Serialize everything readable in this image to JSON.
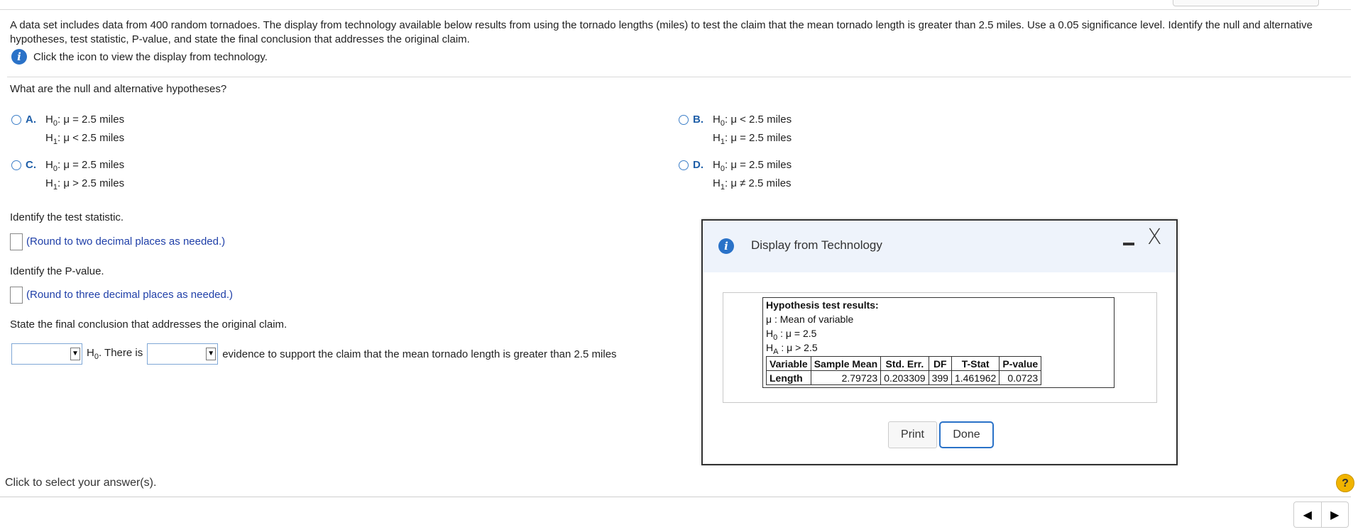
{
  "problem_text": "A data set includes data from 400 random tornadoes. The display from technology available below results from using the tornado lengths (miles) to test the claim that the mean tornado length is greater than 2.5 miles. Use a 0.05 significance level. Identify the null and alternative hypotheses, test statistic, P-value, and state the final conclusion that addresses the original claim.",
  "info_link": "Click the icon to view the display from technology.",
  "info_icon": "i",
  "q1": "What are the null and alternative hypotheses?",
  "options": [
    {
      "letter": "A.",
      "h0": "μ = 2.5 miles",
      "h1": "μ < 2.5 miles"
    },
    {
      "letter": "B.",
      "h0": "μ < 2.5 miles",
      "h1": "μ = 2.5 miles"
    },
    {
      "letter": "C.",
      "h0": "μ = 2.5 miles",
      "h1": "μ > 2.5 miles"
    },
    {
      "letter": "D.",
      "h0": "μ = 2.5 miles",
      "h1": "μ ≠ 2.5 miles"
    }
  ],
  "h_labels": {
    "H": "H",
    "sub0": "0",
    "sub1": "1",
    "colon": ":"
  },
  "q2": "Identify the test statistic.",
  "q2_hint": "(Round to two decimal places as needed.)",
  "q3": "Identify the P-value.",
  "q3_hint": "(Round to three decimal places as needed.)",
  "q4": "State the final conclusion that addresses the original claim.",
  "conclusion": {
    "h": "H",
    "sub": "0",
    "middle": ". There is",
    "tail": "evidence to support the claim that the mean tornado length is greater than 2.5 miles",
    "select1_value": "",
    "select2_value": "",
    "arrow": "▼"
  },
  "footer": "Click to select your answer(s).",
  "help": "?",
  "nav": {
    "prev": "◀",
    "next": "▶"
  },
  "dialog": {
    "title": "Display from Technology",
    "close": "X",
    "results_title": "Hypothesis test results:",
    "mu_line": "μ : Mean of variable",
    "h0_line": "μ = 2.5",
    "ha_line": "μ > 2.5",
    "h0_label": "H",
    "h0_sub": "0",
    "ha_label": "H",
    "ha_sub": "A",
    "headers": [
      "Variable",
      "Sample Mean",
      "Std. Err.",
      "DF",
      "T-Stat",
      "P-value"
    ],
    "row": [
      "Length",
      "2.79723",
      "0.203309",
      "399",
      "1.461962",
      "0.0723"
    ],
    "print_label": "Print",
    "done_label": "Done"
  },
  "colors": {
    "accent": "#2a72c8",
    "hint": "#1f3fa8",
    "help": "#f1b400"
  }
}
